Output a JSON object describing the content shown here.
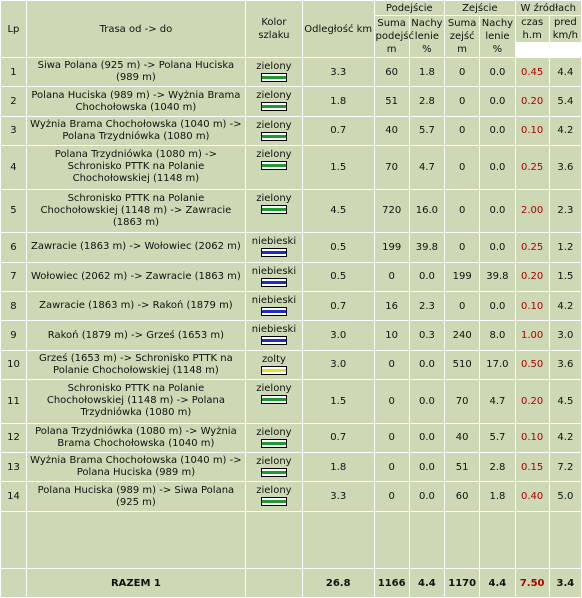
{
  "headers": {
    "lp": "Lp",
    "route": "Trasa od -> do",
    "color": "Kolor szlaku",
    "distance": "Odległość km",
    "ascent_group": "Podejście",
    "descent_group": "Zejście",
    "sources_group": "W źródłach",
    "ascent_sum": "Suma podejść m",
    "ascent_slope": "Nachy lenie %",
    "descent_sum": "Suma zejść m",
    "descent_slope": "Nachy lenie %",
    "time": "czas h.m",
    "speed": "pred km/h"
  },
  "rows": [
    {
      "lp": "1",
      "route": "Siwa Polana (925 m) -> Polana Huciska (989 m)",
      "color": "zielony",
      "color_hex": "#1f9a2e",
      "dist": "3.3",
      "asum": "60",
      "aslope": "1.8",
      "dsum": "0",
      "dslope": "0.0",
      "time": "0.45",
      "speed": "4.4"
    },
    {
      "lp": "2",
      "route": "Polana Huciska (989 m) -> Wyżnia Brama Chochołowska (1040 m)",
      "color": "zielony",
      "color_hex": "#1f9a2e",
      "dist": "1.8",
      "asum": "51",
      "aslope": "2.8",
      "dsum": "0",
      "dslope": "0.0",
      "time": "0.20",
      "speed": "5.4"
    },
    {
      "lp": "3",
      "route": "Wyżnia Brama Chochołowska (1040 m) -> Polana Trzydniówka (1080 m)",
      "color": "zielony",
      "color_hex": "#1f9a2e",
      "dist": "0.7",
      "asum": "40",
      "aslope": "5.7",
      "dsum": "0",
      "dslope": "0.0",
      "time": "0.10",
      "speed": "4.2"
    },
    {
      "lp": "4",
      "route": "Polana Trzydniówka (1080 m) -> Schronisko PTTK na Polanie Chochołowskiej (1148 m)",
      "color": "zielony",
      "color_hex": "#1f9a2e",
      "dist": "1.5",
      "asum": "70",
      "aslope": "4.7",
      "dsum": "0",
      "dslope": "0.0",
      "time": "0.25",
      "speed": "3.6"
    },
    {
      "lp": "5",
      "route": "Schronisko PTTK na Polanie Chochołowskiej (1148 m) -> Zawracie (1863 m)",
      "color": "zielony",
      "color_hex": "#1f9a2e",
      "dist": "4.5",
      "asum": "720",
      "aslope": "16.0",
      "dsum": "0",
      "dslope": "0.0",
      "time": "2.00",
      "speed": "2.3"
    },
    {
      "lp": "6",
      "route": "Zawracie (1863 m) -> Wołowiec (2062 m)",
      "color": "niebieski",
      "color_hex": "#1a2fc8",
      "dist": "0.5",
      "asum": "199",
      "aslope": "39.8",
      "dsum": "0",
      "dslope": "0.0",
      "time": "0.25",
      "speed": "1.2"
    },
    {
      "lp": "7",
      "route": "Wołowiec (2062 m) -> Zawracie (1863 m)",
      "color": "niebieski",
      "color_hex": "#1a2fc8",
      "dist": "0.5",
      "asum": "0",
      "aslope": "0.0",
      "dsum": "199",
      "dslope": "39.8",
      "time": "0.20",
      "speed": "1.5"
    },
    {
      "lp": "8",
      "route": "Zawracie (1863 m) -> Rakoń (1879 m)",
      "color": "niebieski",
      "color_hex": "#1a2fc8",
      "dist": "0.7",
      "asum": "16",
      "aslope": "2.3",
      "dsum": "0",
      "dslope": "0.0",
      "time": "0.10",
      "speed": "4.2"
    },
    {
      "lp": "9",
      "route": "Rakoń (1879 m) -> Grześ (1653 m)",
      "color": "niebieski",
      "color_hex": "#1a2fc8",
      "dist": "3.0",
      "asum": "10",
      "aslope": "0.3",
      "dsum": "240",
      "dslope": "8.0",
      "time": "1.00",
      "speed": "3.0"
    },
    {
      "lp": "10",
      "route": "Grześ (1653 m) -> Schronisko PTTK na Polanie Chochołowskiej (1148 m)",
      "color": "zolty",
      "color_hex": "#e8e020",
      "dist": "3.0",
      "asum": "0",
      "aslope": "0.0",
      "dsum": "510",
      "dslope": "17.0",
      "time": "0.50",
      "speed": "3.6"
    },
    {
      "lp": "11",
      "route": "Schronisko PTTK na Polanie Chochołowskiej (1148 m) -> Polana Trzydniówka (1080 m)",
      "color": "zielony",
      "color_hex": "#1f9a2e",
      "dist": "1.5",
      "asum": "0",
      "aslope": "0.0",
      "dsum": "70",
      "dslope": "4.7",
      "time": "0.20",
      "speed": "4.5"
    },
    {
      "lp": "12",
      "route": "Polana Trzydniówka (1080 m) -> Wyżnia Brama Chochołowska (1040 m)",
      "color": "zielony",
      "color_hex": "#1f9a2e",
      "dist": "0.7",
      "asum": "0",
      "aslope": "0.0",
      "dsum": "40",
      "dslope": "5.7",
      "time": "0.10",
      "speed": "4.2"
    },
    {
      "lp": "13",
      "route": "Wyżnia Brama Chochołowska (1040 m) -> Polana Huciska (989 m)",
      "color": "zielony",
      "color_hex": "#1f9a2e",
      "dist": "1.8",
      "asum": "0",
      "aslope": "0.0",
      "dsum": "51",
      "dslope": "2.8",
      "time": "0.15",
      "speed": "7.2"
    },
    {
      "lp": "14",
      "route": "Polana Huciska (989 m) -> Siwa Polana (925 m)",
      "color": "zielony",
      "color_hex": "#1f9a2e",
      "dist": "3.3",
      "asum": "0",
      "aslope": "0.0",
      "dsum": "60",
      "dslope": "1.8",
      "time": "0.40",
      "speed": "5.0"
    }
  ],
  "total": {
    "label": "RAZEM 1",
    "dist": "26.8",
    "asum": "1166",
    "aslope": "4.4",
    "dsum": "1170",
    "dslope": "4.4",
    "time": "7.50",
    "speed": "3.4"
  }
}
